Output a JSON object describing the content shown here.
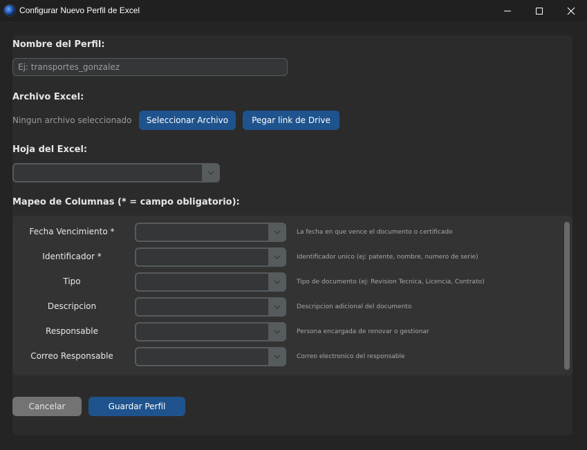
{
  "window": {
    "title": "Configurar Nuevo Perfil de Excel",
    "controls": {
      "minimize": "minimize-icon",
      "maximize": "maximize-icon",
      "close": "close-icon"
    }
  },
  "profile": {
    "name_label": "Nombre del Perfil:",
    "name_placeholder": "Ej: transportes_gonzalez",
    "name_value": ""
  },
  "excel_file": {
    "label": "Archivo Excel:",
    "status": "Ningun archivo seleccionado",
    "select_button": "Seleccionar Archivo",
    "drive_button": "Pegar link de Drive"
  },
  "sheet": {
    "label": "Hoja del Excel:",
    "selected": ""
  },
  "mapping": {
    "label": "Mapeo de Columnas (* = campo obligatorio):",
    "rows": [
      {
        "field": "Fecha Vencimiento *",
        "selected": "",
        "description": "La fecha en que vence el documento o certificado"
      },
      {
        "field": "Identificador *",
        "selected": "",
        "description": "Identificador unico (ej: patente, nombre, numero de serie)"
      },
      {
        "field": "Tipo",
        "selected": "",
        "description": "Tipo de documento (ej: Revision Tecnica, Licencia, Contrato)"
      },
      {
        "field": "Descripcion",
        "selected": "",
        "description": "Descripcion adicional del documento"
      },
      {
        "field": "Responsable",
        "selected": "",
        "description": "Persona encargada de renovar o gestionar"
      },
      {
        "field": "Correo Responsable",
        "selected": "",
        "description": "Correo electronico del responsable"
      }
    ]
  },
  "actions": {
    "cancel": "Cancelar",
    "save": "Guardar Perfil"
  },
  "colors": {
    "primary_button": "#1f538d",
    "cancel_button": "#737373",
    "background": "#242424",
    "panel": "#2b2b2b"
  }
}
